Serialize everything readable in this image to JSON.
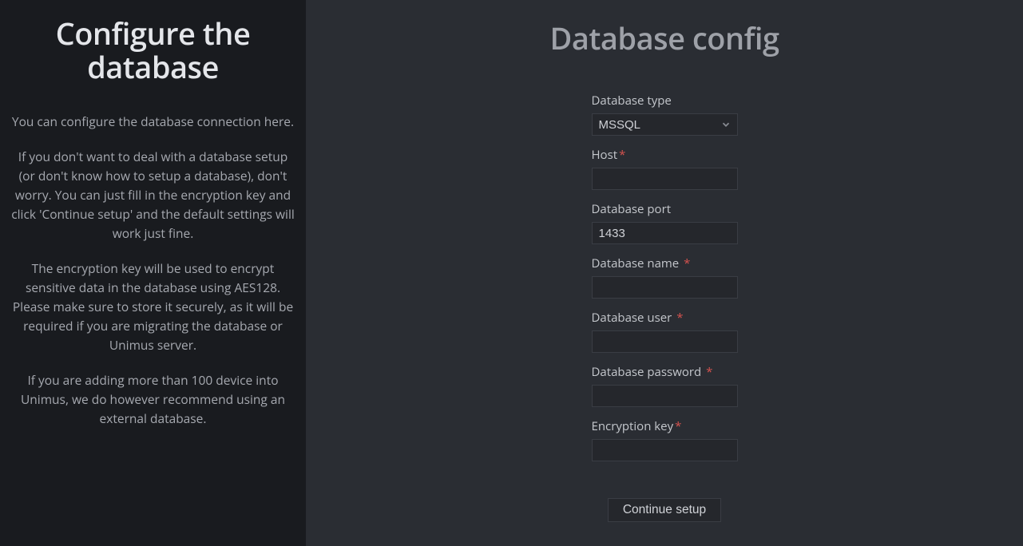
{
  "sidebar": {
    "title": "Configure the database",
    "p1": "You can configure the database connection here.",
    "p2": "If you don't want to deal with a database setup (or don't know how to setup a database), don't worry. You can just fill in the encryption key and click 'Continue setup' and the default settings will work just fine.",
    "p3": "The encryption key will be used to encrypt sensitive data in the database using AES128. Please make sure to store it securely, as it will be required if you are migrating the database or Unimus server.",
    "p4": "If you are adding more than 100 device into Unimus, we do however recommend using an external database."
  },
  "main": {
    "title": "Database config",
    "form": {
      "db_type_label": "Database type",
      "db_type_value": "MSSQL",
      "host_label": "Host",
      "host_value": "",
      "port_label": "Database port",
      "port_value": "1433",
      "name_label": "Database name",
      "name_value": "",
      "user_label": "Database user",
      "user_value": "",
      "password_label": "Database password",
      "password_value": "",
      "enc_key_label": "Encryption key",
      "enc_key_value": "",
      "submit_label": "Continue setup",
      "required_marker": "*"
    }
  }
}
